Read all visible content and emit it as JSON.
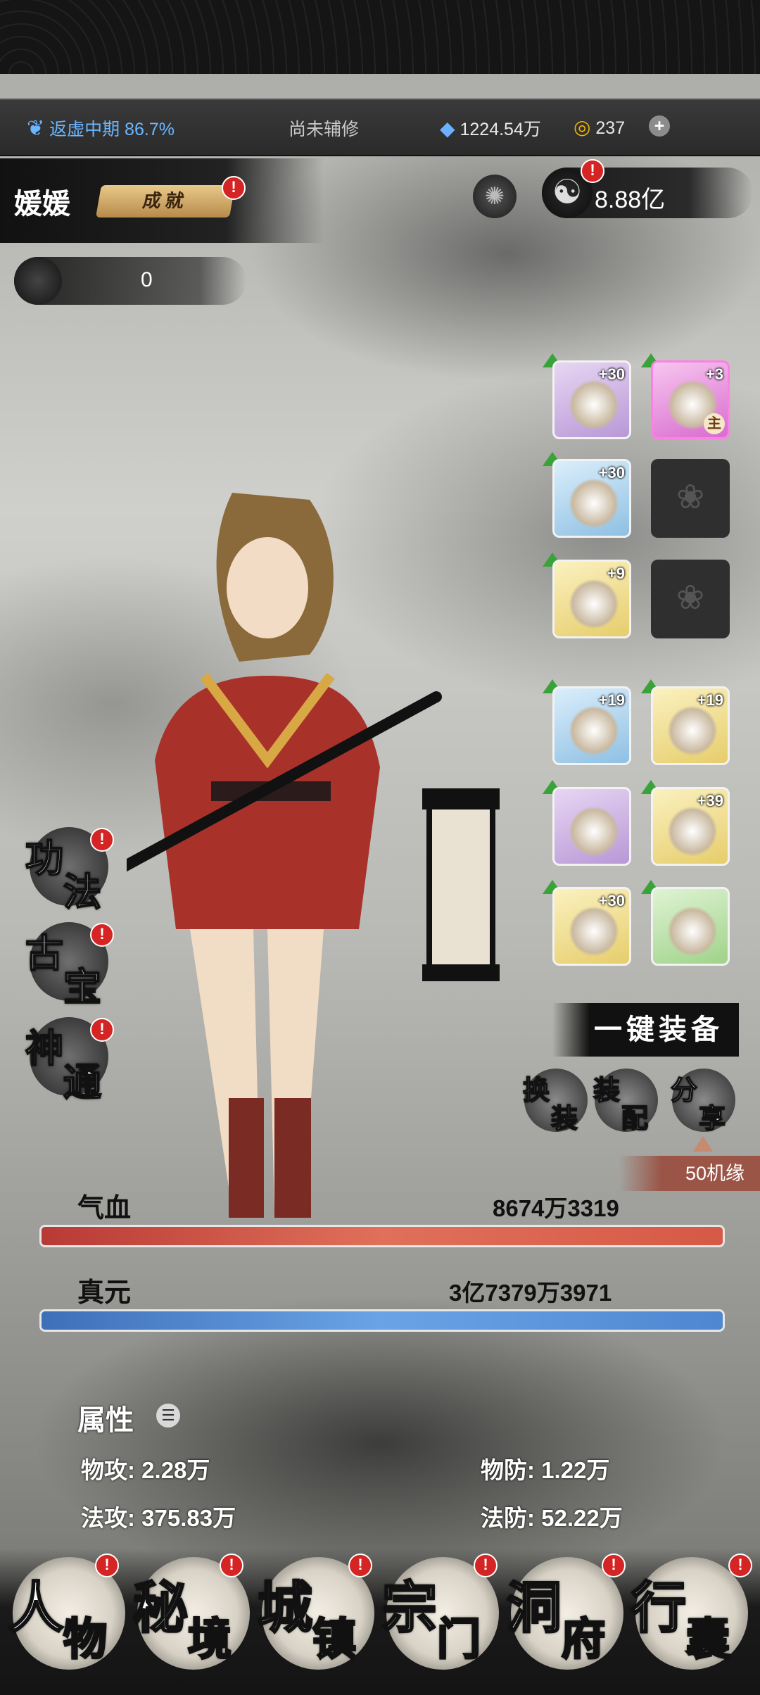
{
  "status": {
    "realm": "返虚中期 86.7%",
    "cultivation": "尚未辅修",
    "spirit_stones": "1224.54万",
    "gold": "237"
  },
  "player": {
    "name": "媛媛",
    "achievement_label": "成就",
    "token_count": "0",
    "power": "8.88亿"
  },
  "equipment": [
    {
      "level": "+30",
      "rarity": "purple",
      "icon": "fan-icon"
    },
    {
      "level": "+3",
      "rarity": "pink",
      "icon": "lotus-flame-icon",
      "main_label": "主"
    },
    {
      "level": "+30",
      "rarity": "blue",
      "icon": "robe-icon"
    },
    {
      "level": "",
      "rarity": "empty",
      "icon": "lotus-lock-icon"
    },
    {
      "level": "+9",
      "rarity": "yellow",
      "icon": "jade-pendant-icon"
    },
    {
      "level": "",
      "rarity": "empty",
      "icon": "lotus-lock-icon"
    },
    {
      "level": "+19",
      "rarity": "blue",
      "icon": "bagua-mirror-icon"
    },
    {
      "level": "+19",
      "rarity": "yellow",
      "icon": "scroll-icon"
    },
    {
      "level": "",
      "rarity": "purple",
      "icon": "scroll-icon"
    },
    {
      "level": "+39",
      "rarity": "yellow",
      "icon": "scroll-icon"
    },
    {
      "level": "+30",
      "rarity": "yellow",
      "icon": "scroll-icon"
    },
    {
      "level": "",
      "rarity": "green",
      "icon": "orb-icon"
    }
  ],
  "side_buttons": [
    {
      "c1": "功",
      "c2": "法"
    },
    {
      "c1": "古",
      "c2": "宝"
    },
    {
      "c1": "神",
      "c2": "通"
    }
  ],
  "actions": {
    "equip_all": "一键装备",
    "swap": {
      "c1": "换",
      "c2": "装"
    },
    "config": {
      "c1": "装",
      "c2": "配"
    },
    "share": {
      "c1": "分",
      "c2": "享"
    },
    "share_reward": "50机缘"
  },
  "stats": {
    "hp_label": "气血",
    "hp_value": "8674万3319",
    "hp_fraction": 1.0,
    "mp_label": "真元",
    "mp_value": "3亿7379万3971",
    "mp_fraction": 1.0
  },
  "attributes": {
    "title": "属性",
    "phys_atk_label": "物攻:",
    "phys_atk": "2.28万",
    "phys_def_label": "物防:",
    "phys_def": "1.22万",
    "mag_atk_label": "法攻:",
    "mag_atk": "375.83万",
    "mag_def_label": "法防:",
    "mag_def": "52.22万"
  },
  "tabs": [
    {
      "c1": "人",
      "c2": "物"
    },
    {
      "c1": "秘",
      "c2": "境"
    },
    {
      "c1": "城",
      "c2": "镇"
    },
    {
      "c1": "宗",
      "c2": "门"
    },
    {
      "c1": "洞",
      "c2": "府"
    },
    {
      "c1": "行",
      "c2": "囊"
    }
  ]
}
